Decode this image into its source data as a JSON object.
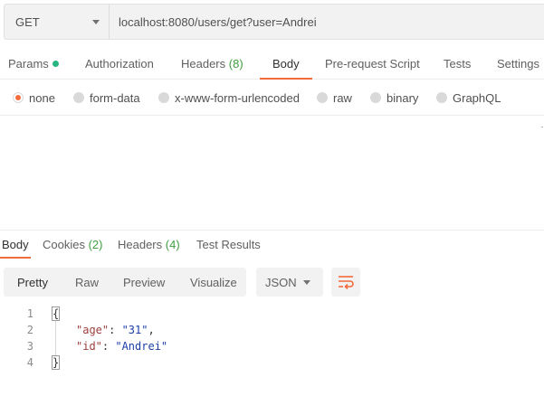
{
  "request": {
    "method": "GET",
    "url": "localhost:8080/users/get?user=Andrei"
  },
  "request_tabs": [
    {
      "label": "Params",
      "count": "",
      "has_dot": true
    },
    {
      "label": "Authorization",
      "count": ""
    },
    {
      "label": "Headers",
      "count": "(8)"
    },
    {
      "label": "Body",
      "count": "",
      "active": true
    },
    {
      "label": "Pre-request Script",
      "count": ""
    },
    {
      "label": "Tests",
      "count": ""
    },
    {
      "label": "Settings",
      "count": ""
    }
  ],
  "body_types": [
    {
      "label": "none",
      "selected": true
    },
    {
      "label": "form-data"
    },
    {
      "label": "x-www-form-urlencoded"
    },
    {
      "label": "raw"
    },
    {
      "label": "binary"
    },
    {
      "label": "GraphQL"
    }
  ],
  "response_tabs": [
    {
      "label": "Body",
      "count": "",
      "active": true
    },
    {
      "label": "Cookies",
      "count": "(2)"
    },
    {
      "label": "Headers",
      "count": "(4)"
    },
    {
      "label": "Test Results",
      "count": ""
    }
  ],
  "view_modes": [
    "Pretty",
    "Raw",
    "Preview",
    "Visualize"
  ],
  "active_view": "Pretty",
  "format": "JSON",
  "response_code": {
    "lines": [
      {
        "num": "1",
        "open": "{"
      },
      {
        "num": "2",
        "key": "\"age\"",
        "sep": ": ",
        "value": "\"31\"",
        "trail": ","
      },
      {
        "num": "3",
        "key": "\"id\"",
        "sep": ": ",
        "value": "\"Andrei\"",
        "trail": ""
      },
      {
        "num": "4",
        "close": "}"
      }
    ]
  },
  "colors": {
    "accent": "#f26b3a",
    "count_green": "#3f9d3f",
    "status_dot": "#26b47f",
    "json_key": "#9c3d3d",
    "json_string": "#1c3fa8"
  },
  "icons": {
    "method_dropdown": "chevron-down-icon",
    "format_dropdown": "chevron-down-icon",
    "wrap": "wrap-lines-icon"
  }
}
